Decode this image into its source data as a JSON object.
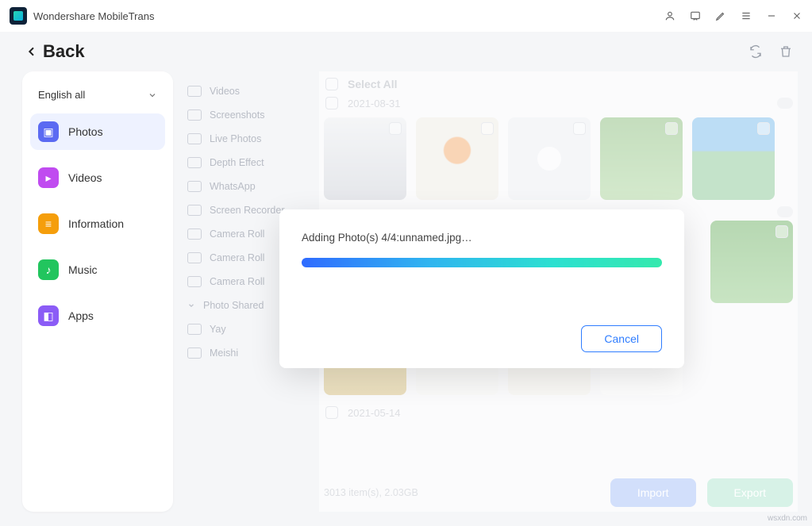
{
  "app": {
    "title": "Wondershare MobileTrans"
  },
  "back": {
    "label": "Back"
  },
  "sidebar": {
    "lang": "English all",
    "items": [
      {
        "label": "Photos"
      },
      {
        "label": "Videos"
      },
      {
        "label": "Information"
      },
      {
        "label": "Music"
      },
      {
        "label": "Apps"
      }
    ]
  },
  "sublist": {
    "items": [
      {
        "label": "Videos"
      },
      {
        "label": "Screenshots"
      },
      {
        "label": "Live Photos"
      },
      {
        "label": "Depth Effect"
      },
      {
        "label": "WhatsApp"
      },
      {
        "label": "Screen Recorder"
      },
      {
        "label": "Camera Roll"
      },
      {
        "label": "Camera Roll"
      },
      {
        "label": "Camera Roll"
      },
      {
        "label": "Photo Shared"
      },
      {
        "label": "Yay"
      },
      {
        "label": "Meishi"
      }
    ]
  },
  "content": {
    "select_all": "Select All",
    "date1": "2021-08-31",
    "date2": "2021-05-14",
    "summary": "3013 item(s), 2.03GB",
    "import": "Import",
    "export": "Export"
  },
  "modal": {
    "message": "Adding Photo(s) 4/4:unnamed.jpg…",
    "cancel": "Cancel"
  },
  "watermark": "wsxdn.com"
}
